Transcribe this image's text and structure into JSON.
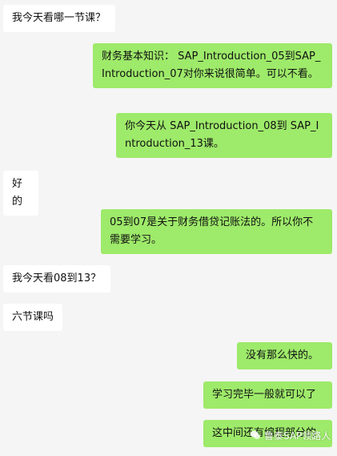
{
  "messages": [
    {
      "side": "left",
      "text": "我今天看哪一节课？"
    },
    {
      "side": "right",
      "text": "财务基本知识： SAP_Introduction_05到SAP_Introduction_07对你来说很简单。可以不看。"
    },
    {
      "side": "right",
      "text": "你今天从 SAP_Introduction_08到 SAP_Introduction_13课。"
    },
    {
      "side": "left",
      "text": "好的"
    },
    {
      "side": "right",
      "text": "05到07是关于财务借贷记账法的。所以你不需要学习。"
    },
    {
      "side": "left",
      "text": "我今天看08到13？"
    },
    {
      "side": "left",
      "text": "六节课吗"
    },
    {
      "side": "right",
      "text": "没有那么快的。"
    },
    {
      "side": "right",
      "text": "学习完毕一般就可以了"
    },
    {
      "side": "right",
      "text": "这中间还有编程部分的"
    }
  ],
  "watermark": {
    "icon": "wechat-icon",
    "text": "鲁泰SAP领路人"
  },
  "colors": {
    "background": "#f5f5f5",
    "left_bubble": "#ffffff",
    "right_bubble": "#9eea6a"
  }
}
